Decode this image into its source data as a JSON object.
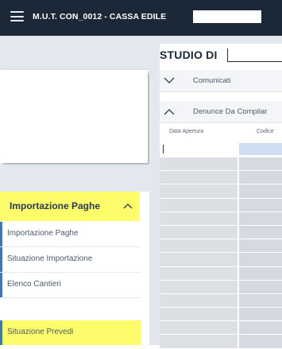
{
  "header": {
    "title": "M.U.T. CON_0012 - CASSA EDILE",
    "menu_icon": "hamburger-menu-icon",
    "background": "#1b2838"
  },
  "sidebar": {
    "section": {
      "label": "Importazione Paghe",
      "icon": "chevron-up-icon",
      "highlight": "#fdfd6b"
    },
    "items": [
      {
        "label": "Importazione Paghe",
        "highlighted": false
      },
      {
        "label": "Situazione Importazione",
        "highlighted": false
      },
      {
        "label": "Elenco Cantieri",
        "highlighted": false
      },
      {
        "label": "Situazione Prevedi",
        "highlighted": true
      }
    ],
    "accent": "#3a79b8"
  },
  "main": {
    "title": "STUDIO DI",
    "accordion": [
      {
        "label": "Comunicati",
        "icon": "chevron-down-icon"
      },
      {
        "label": "Denunce Da Compilar",
        "icon": "chevron-up-icon"
      }
    ],
    "table": {
      "columns": [
        "Data Apertura",
        "Codice"
      ],
      "selected_cell_color": "#cfdef0"
    }
  }
}
